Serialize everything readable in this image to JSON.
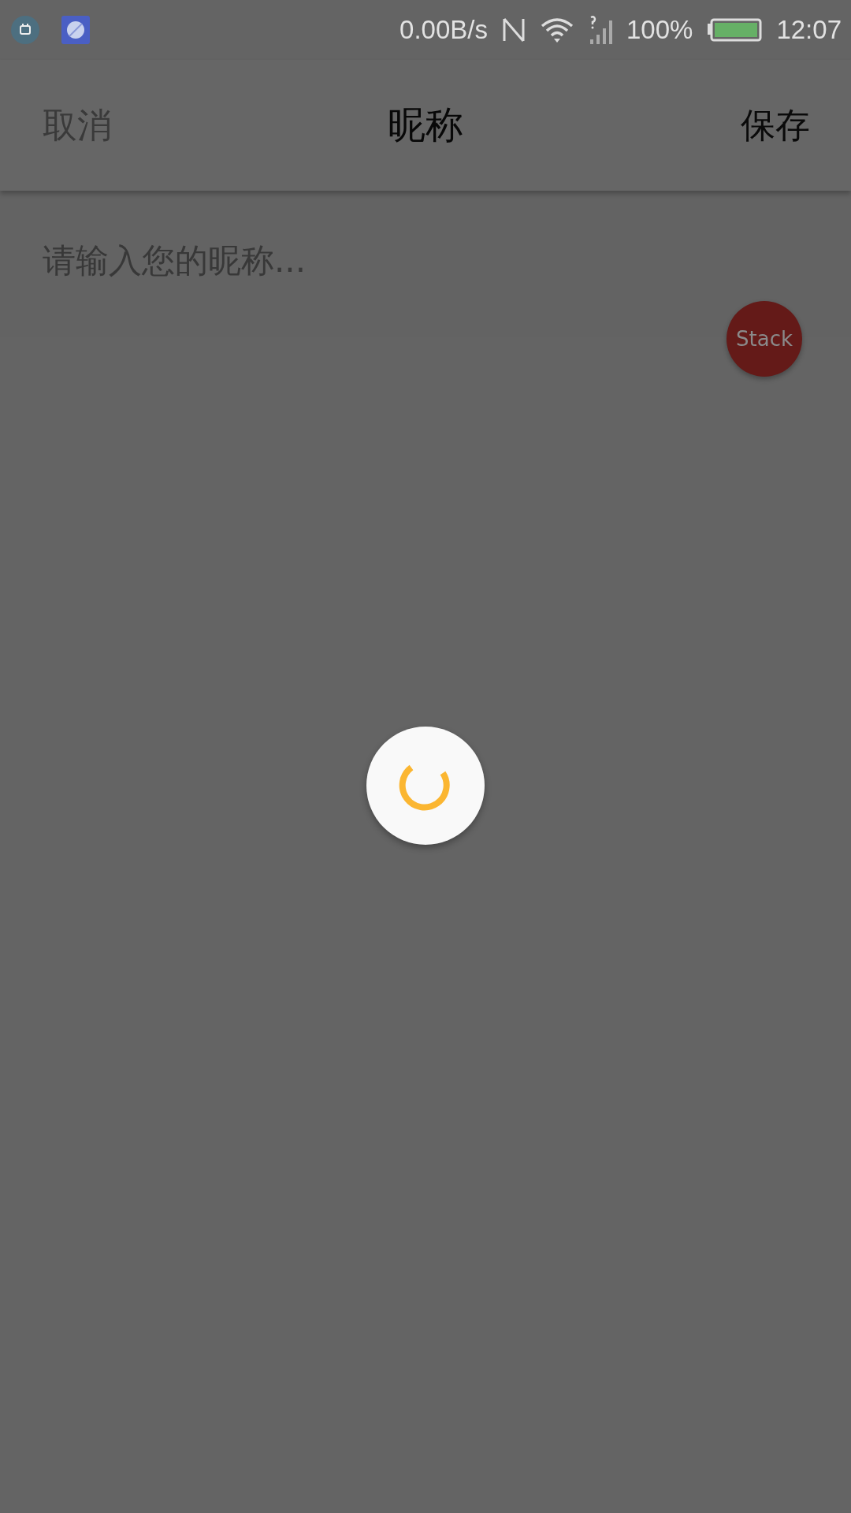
{
  "status_bar": {
    "network_speed": "0.00B/s",
    "battery": "100%",
    "time": "12:07"
  },
  "app_bar": {
    "cancel": "取消",
    "title": "昵称",
    "save": "保存"
  },
  "nickname_field": {
    "placeholder": "请输入您的昵称..."
  },
  "stack_button": {
    "label": "Stack"
  }
}
